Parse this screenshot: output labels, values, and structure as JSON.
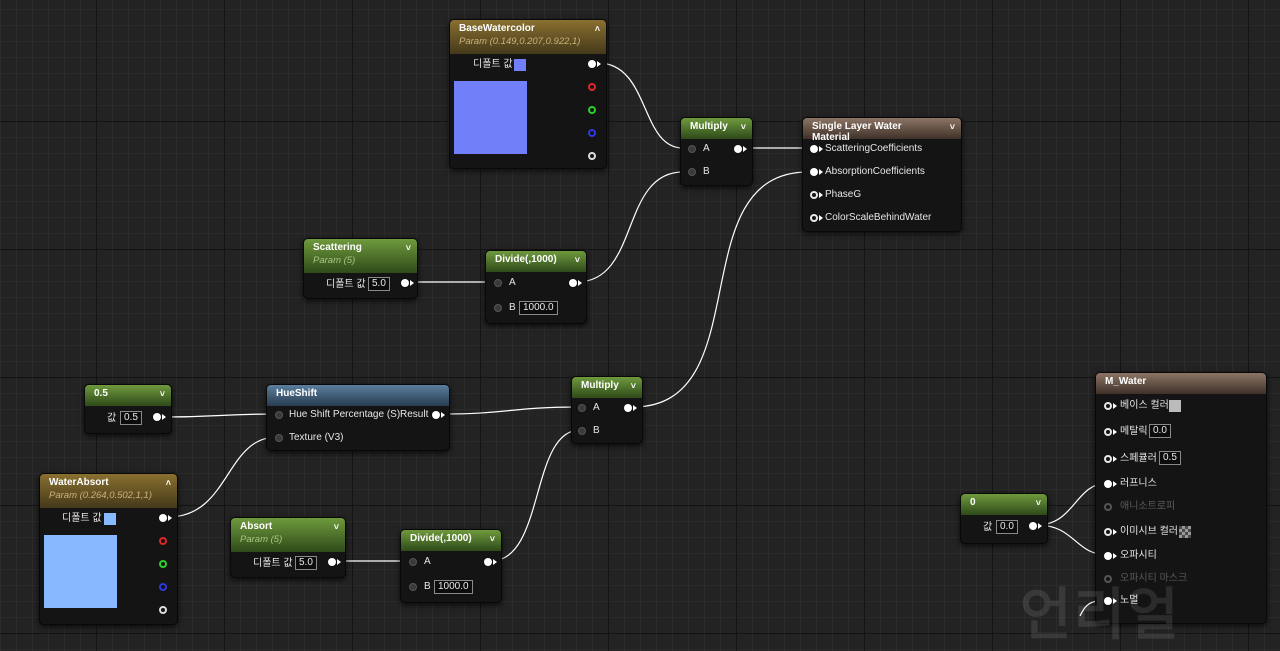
{
  "colors": {
    "base_water": "#7180f8",
    "water_absorb": "#88b8ff",
    "base_color_swatch": "#bbbbbb"
  },
  "nodes": {
    "base_watercolor": {
      "title": "BaseWatercolor",
      "sub": "Param (0.149,0.207,0.922,1)",
      "default_label": "디폴트 값",
      "icon": "chevron-up-icon"
    },
    "scattering": {
      "title": "Scattering",
      "sub": "Param (5)",
      "default_label": "디폴트 값",
      "value": "5.0"
    },
    "divide1": {
      "title": "Divide(,1000)",
      "a": "A",
      "b": "B",
      "b_value": "1000.0"
    },
    "multiply1": {
      "title": "Multiply",
      "a": "A",
      "b": "B"
    },
    "single_layer": {
      "title": "Single Layer Water Material",
      "inputs": [
        "ScatteringCoefficients",
        "AbsorptionCoefficients",
        "PhaseG",
        "ColorScaleBehindWater"
      ]
    },
    "const05": {
      "title": "0.5",
      "value_label": "값",
      "value": "0.5"
    },
    "hueshift": {
      "title": "HueShift",
      "in1": "Hue Shift Percentage (S)",
      "in2": "Texture (V3)",
      "out": "Result"
    },
    "multiply2": {
      "title": "Multiply",
      "a": "A",
      "b": "B"
    },
    "water_absorb": {
      "title": "WaterAbsort",
      "sub": "Param (0.264,0.502,1,1)",
      "default_label": "디폴트 값"
    },
    "absort": {
      "title": "Absort",
      "sub": "Param (5)",
      "default_label": "디폴트 값",
      "value": "5.0"
    },
    "divide2": {
      "title": "Divide(,1000)",
      "a": "A",
      "b": "B",
      "b_value": "1000.0"
    },
    "const0": {
      "title": "0",
      "value_label": "값",
      "value": "0.0"
    },
    "m_water": {
      "title": "M_Water",
      "base_color": "베이스 컬러",
      "metallic": "메탈릭",
      "metallic_value": "0.0",
      "specular": "스페큘러",
      "specular_value": "0.5",
      "roughness": "러프니스",
      "anisotropy": "애니소트로피",
      "emissive": "이미시브 컬러",
      "opacity": "오파시티",
      "opacity_mask": "오파시티 마스크",
      "normal": "노멀"
    }
  },
  "watermark": "언리얼"
}
